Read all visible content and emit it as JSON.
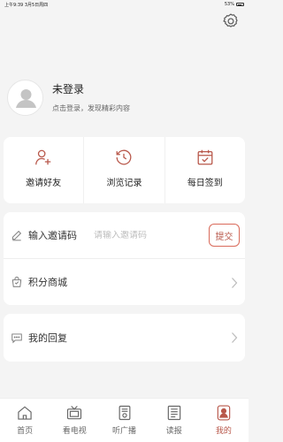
{
  "status_bar": {
    "time_date": "上午9:39  3月5日周四",
    "battery": "53%"
  },
  "profile": {
    "username": "未登录",
    "hint": "点击登录，发现精彩内容"
  },
  "quick_actions": [
    {
      "label": "邀请好友",
      "icon": "invite-user-icon"
    },
    {
      "label": "浏览记录",
      "icon": "history-clock-icon"
    },
    {
      "label": "每日签到",
      "icon": "calendar-check-icon"
    }
  ],
  "invite": {
    "label": "输入邀请码",
    "placeholder": "请输入邀请码",
    "submit": "提交"
  },
  "points_mall": {
    "label": "积分商城"
  },
  "my_replies": {
    "label": "我的回复"
  },
  "tabs": [
    {
      "label": "首页",
      "icon": "home-icon"
    },
    {
      "label": "看电视",
      "icon": "tv-icon"
    },
    {
      "label": "听广播",
      "icon": "radio-icon"
    },
    {
      "label": "读报",
      "icon": "newspaper-icon"
    },
    {
      "label": "我的",
      "icon": "user-icon",
      "active": true
    }
  ],
  "colors": {
    "accent": "#b8574a",
    "background": "#f4f4f4"
  }
}
